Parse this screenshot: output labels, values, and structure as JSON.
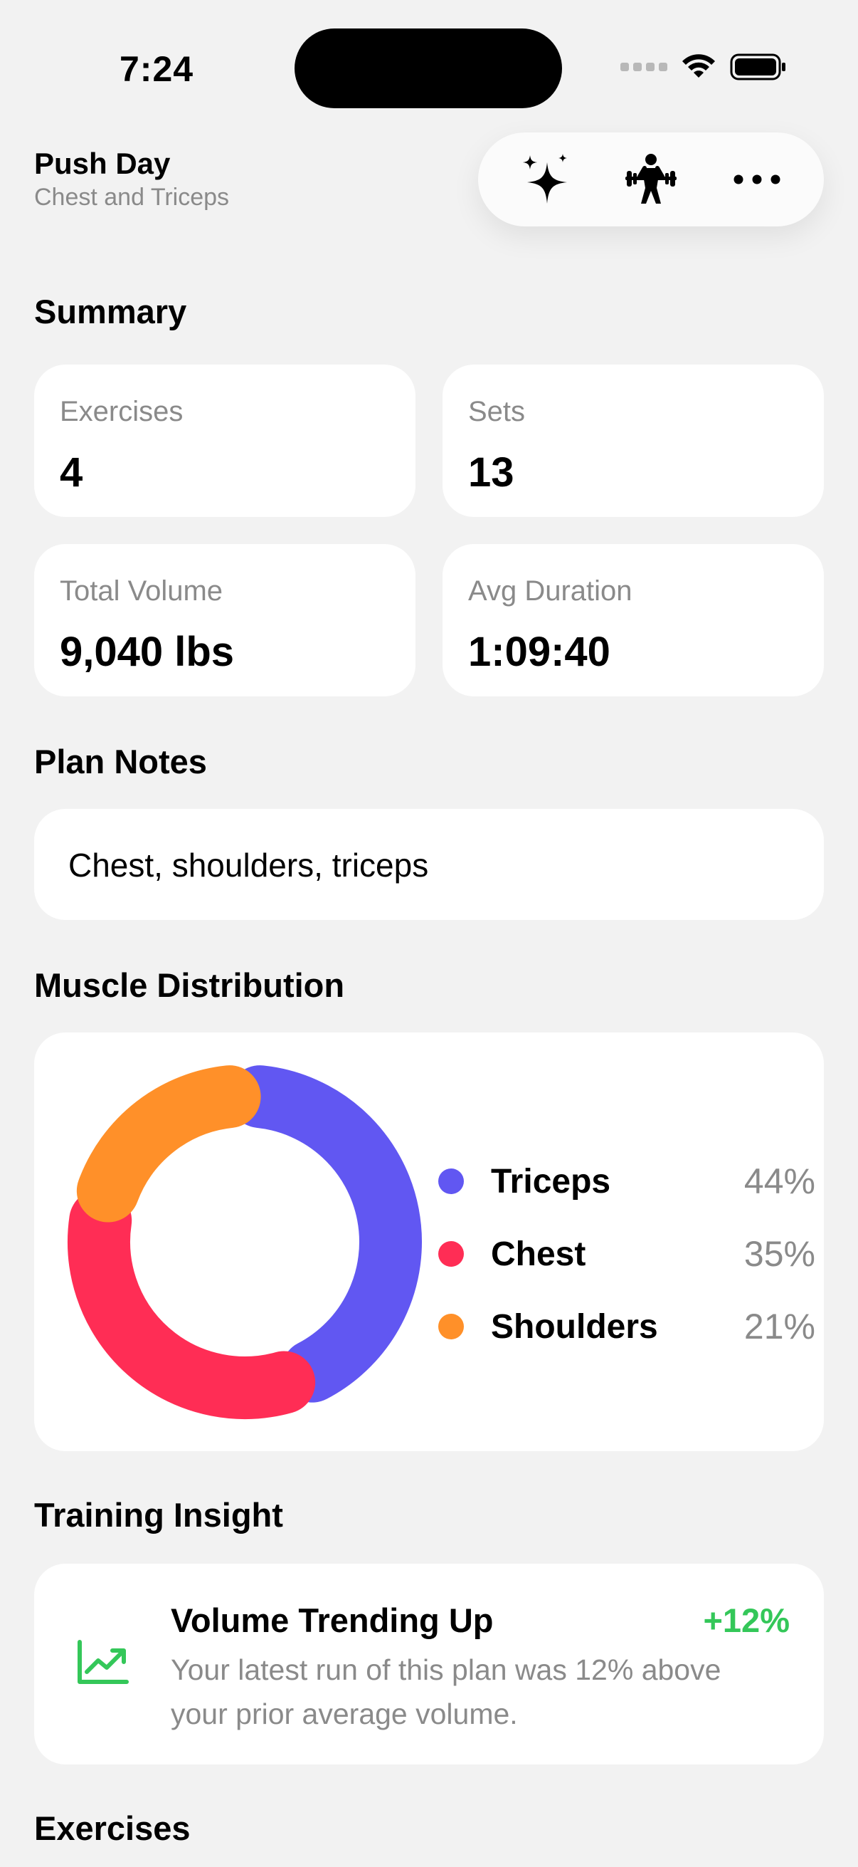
{
  "status_bar": {
    "time": "7:24"
  },
  "header": {
    "title": "Push Day",
    "subtitle": "Chest and Triceps",
    "actions": [
      "sparkles-icon",
      "weightlifter-icon",
      "more-icon"
    ]
  },
  "summary": {
    "title": "Summary",
    "stats": [
      {
        "label": "Exercises",
        "value": "4"
      },
      {
        "label": "Sets",
        "value": "13"
      },
      {
        "label": "Total Volume",
        "value": "9,040 lbs"
      },
      {
        "label": "Avg Duration",
        "value": "1:09:40"
      }
    ]
  },
  "plan_notes": {
    "title": "Plan Notes",
    "text": "Chest, shoulders, triceps"
  },
  "muscle_distribution": {
    "title": "Muscle Distribution",
    "items": [
      {
        "name": "Triceps",
        "percent_label": "44%",
        "percent": 44,
        "color": "#6157f2"
      },
      {
        "name": "Chest",
        "percent_label": "35%",
        "percent": 35,
        "color": "#ff2d55"
      },
      {
        "name": "Shoulders",
        "percent_label": "21%",
        "percent": 21,
        "color": "#ff9029"
      }
    ]
  },
  "training_insight": {
    "title": "Training Insight",
    "headline": "Volume Trending Up",
    "delta": "+12%",
    "body": "Your latest run of this plan was 12% above your prior average volume.",
    "accent": "#34c759",
    "icon": "trend-up-icon"
  },
  "exercises": {
    "title": "Exercises"
  }
}
